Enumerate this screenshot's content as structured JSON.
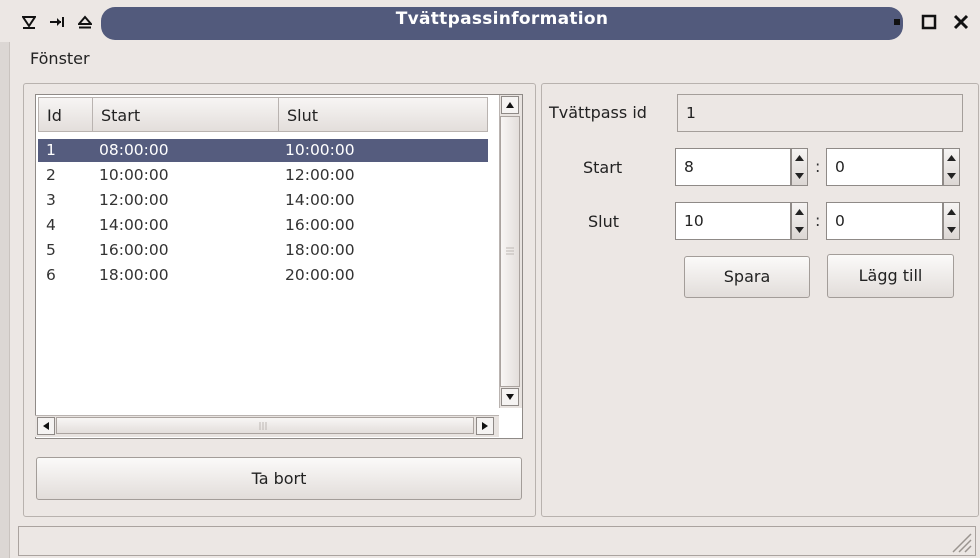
{
  "window": {
    "title": "Tvättpassinformation"
  },
  "menu": {
    "items": [
      "Fönster"
    ]
  },
  "table": {
    "headers": {
      "id": "Id",
      "start": "Start",
      "slut": "Slut"
    },
    "rows": [
      {
        "id": "1",
        "start": "08:00:00",
        "slut": "10:00:00",
        "selected": true
      },
      {
        "id": "2",
        "start": "10:00:00",
        "slut": "12:00:00",
        "selected": false
      },
      {
        "id": "3",
        "start": "12:00:00",
        "slut": "14:00:00",
        "selected": false
      },
      {
        "id": "4",
        "start": "14:00:00",
        "slut": "16:00:00",
        "selected": false
      },
      {
        "id": "5",
        "start": "16:00:00",
        "slut": "18:00:00",
        "selected": false
      },
      {
        "id": "6",
        "start": "18:00:00",
        "slut": "20:00:00",
        "selected": false
      }
    ]
  },
  "buttons": {
    "ta_bort": "Ta bort",
    "spara": "Spara",
    "lagg_till": "Lägg till"
  },
  "form": {
    "id_label": "Tvättpass id",
    "id_value": "1",
    "start_label": "Start",
    "start_hour": "8",
    "start_minute": "0",
    "slut_label": "Slut",
    "slut_hour": "10",
    "slut_minute": "0",
    "separator": ":"
  },
  "colors": {
    "title_bar": "#525a7c",
    "selection": "#555c7e",
    "window_bg": "#ece7e4"
  }
}
